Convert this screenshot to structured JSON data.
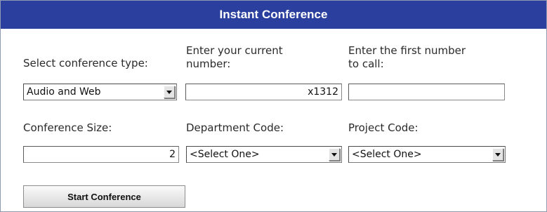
{
  "panel": {
    "title": "Instant Conference"
  },
  "labels": {
    "conference_type": "Select conference type:",
    "current_number": "Enter your current\nnumber:",
    "first_number": "Enter the first number\nto call:",
    "conference_size": "Conference Size:",
    "department_code": "Department Code:",
    "project_code": "Project Code:"
  },
  "fields": {
    "conference_type": {
      "selected": "Audio and Web",
      "icon": "dropdown-arrow-icon"
    },
    "current_number": {
      "value": "x1312"
    },
    "first_number": {
      "value": ""
    },
    "conference_size": {
      "value": "2"
    },
    "department_code": {
      "selected": "<Select One>",
      "icon": "dropdown-arrow-icon"
    },
    "project_code": {
      "selected": "<Select One>",
      "icon": "dropdown-arrow-icon"
    }
  },
  "buttons": {
    "start": "Start Conference"
  },
  "colors": {
    "header_bg": "#2a3f9e",
    "header_text": "#ffffff"
  }
}
